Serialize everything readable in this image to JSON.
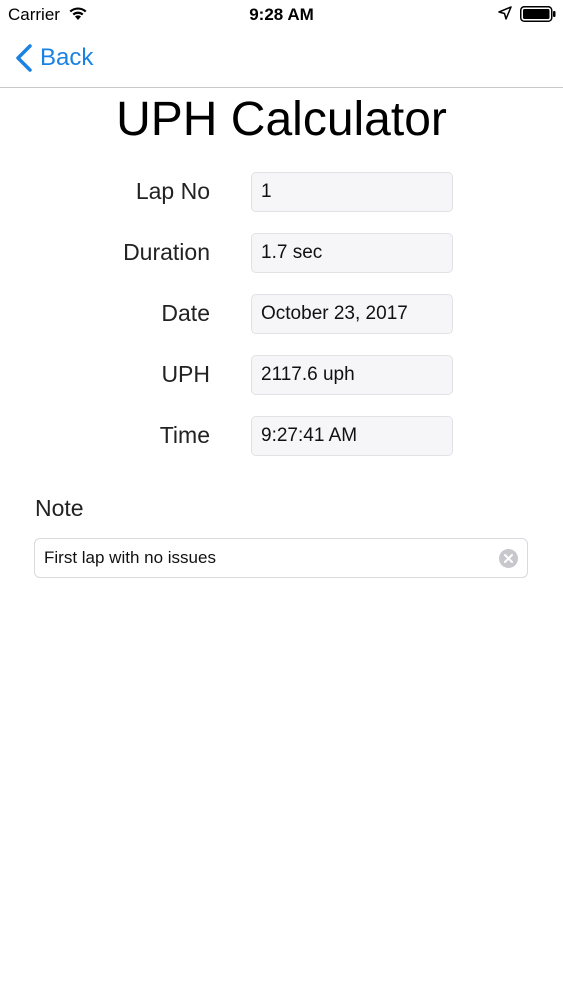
{
  "status_bar": {
    "carrier": "Carrier",
    "time": "9:28 AM",
    "icons": [
      "wifi-icon",
      "location-arrow-icon",
      "battery-icon"
    ]
  },
  "nav": {
    "back_label": "Back",
    "accent_color": "#1a82e2"
  },
  "page": {
    "title": "UPH Calculator"
  },
  "form": {
    "rows": [
      {
        "label": "Lap No",
        "value": "1"
      },
      {
        "label": "Duration",
        "value": "1.7 sec"
      },
      {
        "label": "Date",
        "value": "October 23, 2017"
      },
      {
        "label": "UPH",
        "value": "2117.6 uph"
      },
      {
        "label": "Time",
        "value": "9:27:41 AM"
      }
    ]
  },
  "note": {
    "label": "Note",
    "value": "First lap with no issues"
  }
}
